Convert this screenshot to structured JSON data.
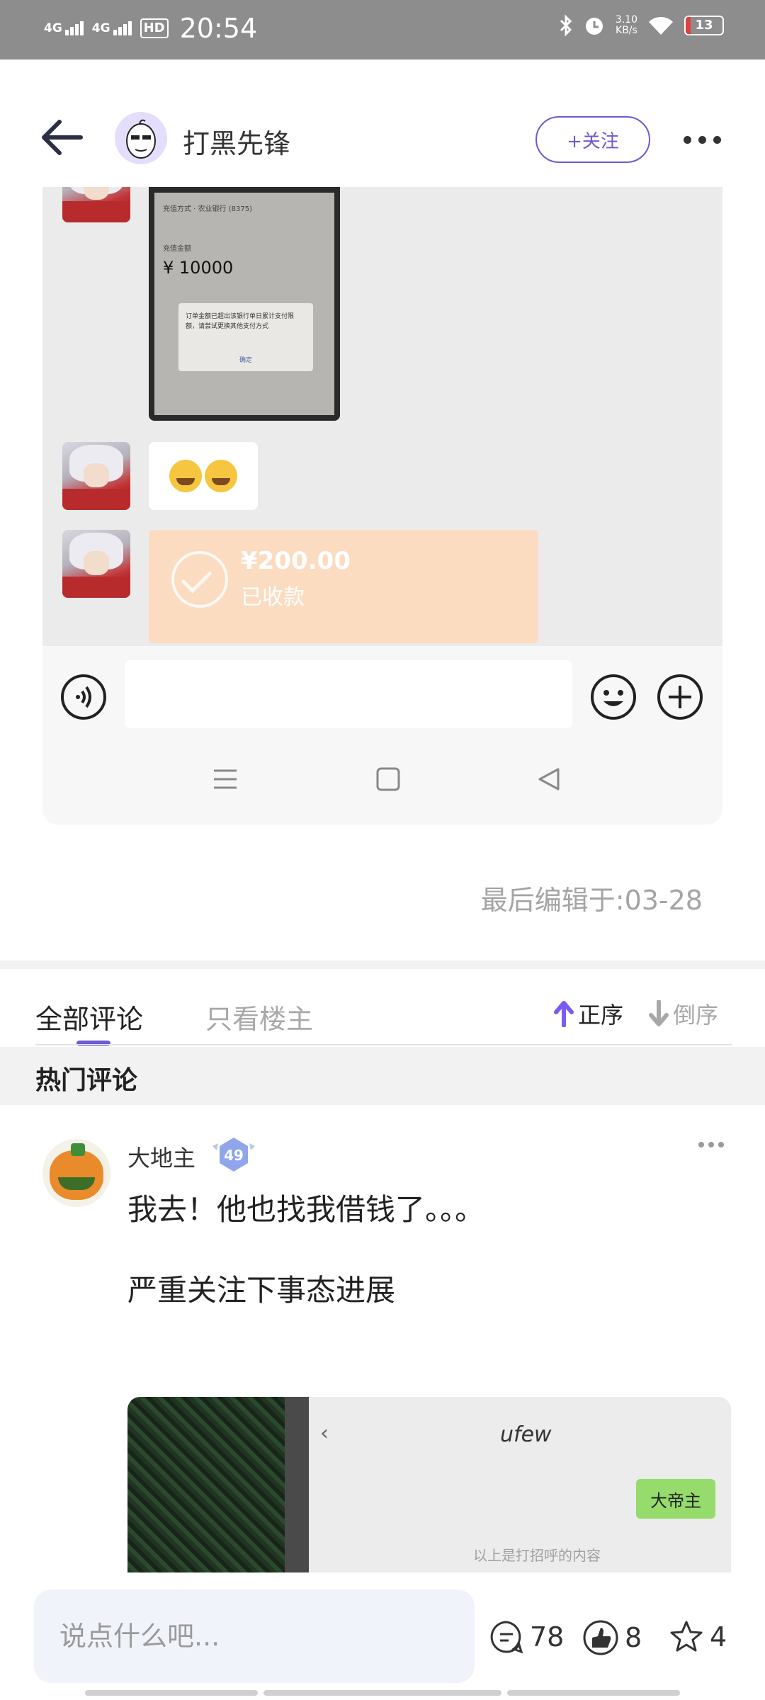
{
  "status_bar": {
    "network1": "4G",
    "network2": "4G",
    "hd": "HD",
    "time": "20:54",
    "speed_value": "3.10",
    "speed_unit": "KB/s",
    "battery": "13"
  },
  "header": {
    "author_name": "打黑先锋",
    "follow_label": "+关注"
  },
  "post_image": {
    "phone_row": "充值方式 · 农业银行 (8375)",
    "amount_label": "充值金额",
    "amount": "¥ 10000",
    "dialog_text": "订单金额已超出该银行单日累计支付限额，请尝试更换其他支付方式",
    "dialog_ok": "确定",
    "payment_amount": "¥200.00",
    "payment_status": "已收款"
  },
  "post": {
    "edited": "最后编辑于:03-28"
  },
  "comments": {
    "tab_all": "全部评论",
    "tab_op": "只看楼主",
    "sort_asc": "正序",
    "sort_desc": "倒序",
    "hot_header": "热门评论",
    "items": [
      {
        "author": "大地主",
        "level": "49",
        "line1": "我去！他也找我借钱了。。。",
        "line2": "严重关注下事态进展",
        "image": {
          "title": "ufew",
          "bubble": "大帝主",
          "note": "以上是打招呼的内容"
        }
      }
    ]
  },
  "bottom_bar": {
    "placeholder": "说点什么吧...",
    "comments_count": "78",
    "likes_count": "8",
    "favorites_count": "4"
  },
  "colors": {
    "accent": "#6b5bd2",
    "status_bar": "#8d8d8d",
    "battery_low": "#e04040",
    "payment_card": "#fbdcc1"
  },
  "icons": [
    "back-arrow-icon",
    "more-dots-icon",
    "voice-icon",
    "smile-icon",
    "plus-icon",
    "comment-icon",
    "like-icon",
    "star-icon",
    "sort-up-icon",
    "sort-down-icon"
  ]
}
